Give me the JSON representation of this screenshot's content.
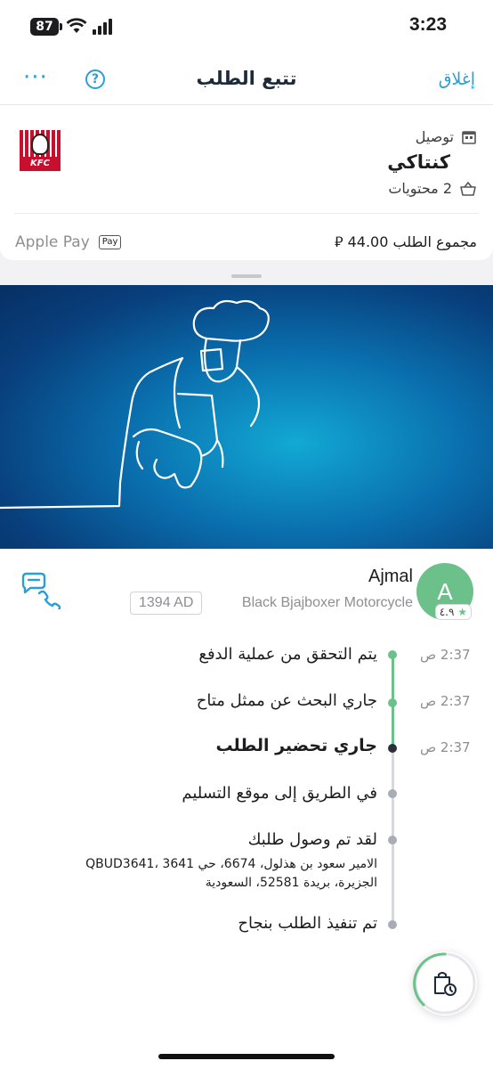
{
  "status_bar": {
    "battery": "87",
    "time": "3:23"
  },
  "nav": {
    "title": "تتبع الطلب",
    "close_label": "إغلاق",
    "more_label": "···",
    "help_label": "?"
  },
  "order": {
    "delivery_type": "توصيل",
    "restaurant": "كنتاكي",
    "items_count": "2 محتويات",
    "payment_method": "Apple Pay",
    "applepay_badge": "Pay",
    "total": "مجموع الطلب 44.00 ⃁",
    "logo_text": "KFC"
  },
  "driver": {
    "name": "Ajmal",
    "initial": "A",
    "rating": "٤.٩",
    "plate": "1394 AD",
    "vehicle": "Black Bjajboxer Motorcycle"
  },
  "timeline": [
    {
      "text": "يتم التحقق من عملية الدفع",
      "time": "2:37 ص",
      "state": "done"
    },
    {
      "text": "جاري البحث عن ممثل متاح",
      "time": "2:37 ص",
      "state": "done"
    },
    {
      "text": "جاري تحضير الطلب",
      "time": "2:37 ص",
      "state": "current"
    },
    {
      "text": "في الطريق إلى موقع التسليم",
      "time": "",
      "state": "pending"
    },
    {
      "text": "لقد تم وصول طلبك",
      "time": "",
      "state": "pending",
      "address_line1": "الامير سعود بن هذلول، 6674، حي 3641 ،QBUD3641",
      "address_line2": "الجزيرة، بريدة 52581، السعودية"
    },
    {
      "text": "تم تنفيذ الطلب بنجاح",
      "time": "",
      "state": "pending"
    }
  ],
  "colors": {
    "accent": "#2a9fd6",
    "green": "#6cc18a",
    "brand_red": "#c8102e"
  },
  "icons": {
    "more": "ellipsis-icon",
    "help": "question-icon",
    "store": "store-icon",
    "basket": "basket-icon",
    "chat_call": "chat-phone-icon",
    "receipt": "order-clock-icon"
  }
}
